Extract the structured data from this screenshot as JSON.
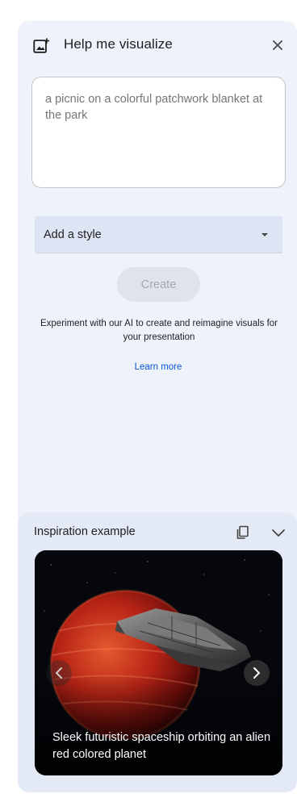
{
  "header": {
    "title": "Help me visualize",
    "icon": "add-photo-icon",
    "close_icon": "close-icon"
  },
  "prompt": {
    "placeholder": "a picnic on a colorful patchwork blanket at the park",
    "value": ""
  },
  "style_select": {
    "label": "Add a style"
  },
  "create_button": {
    "label": "Create",
    "disabled": true
  },
  "description": "Experiment with our AI to create and reimagine visuals for your presentation",
  "learn_more": "Learn more",
  "inspiration": {
    "title": "Inspiration example",
    "example_caption": "Sleek futuristic spaceship orbiting an alien red colored planet"
  },
  "colors": {
    "panel_bg": "#eef2fa",
    "select_bg": "#dde4f3",
    "link": "#0b57d0",
    "inspiration_bg": "#e3e9f5"
  }
}
